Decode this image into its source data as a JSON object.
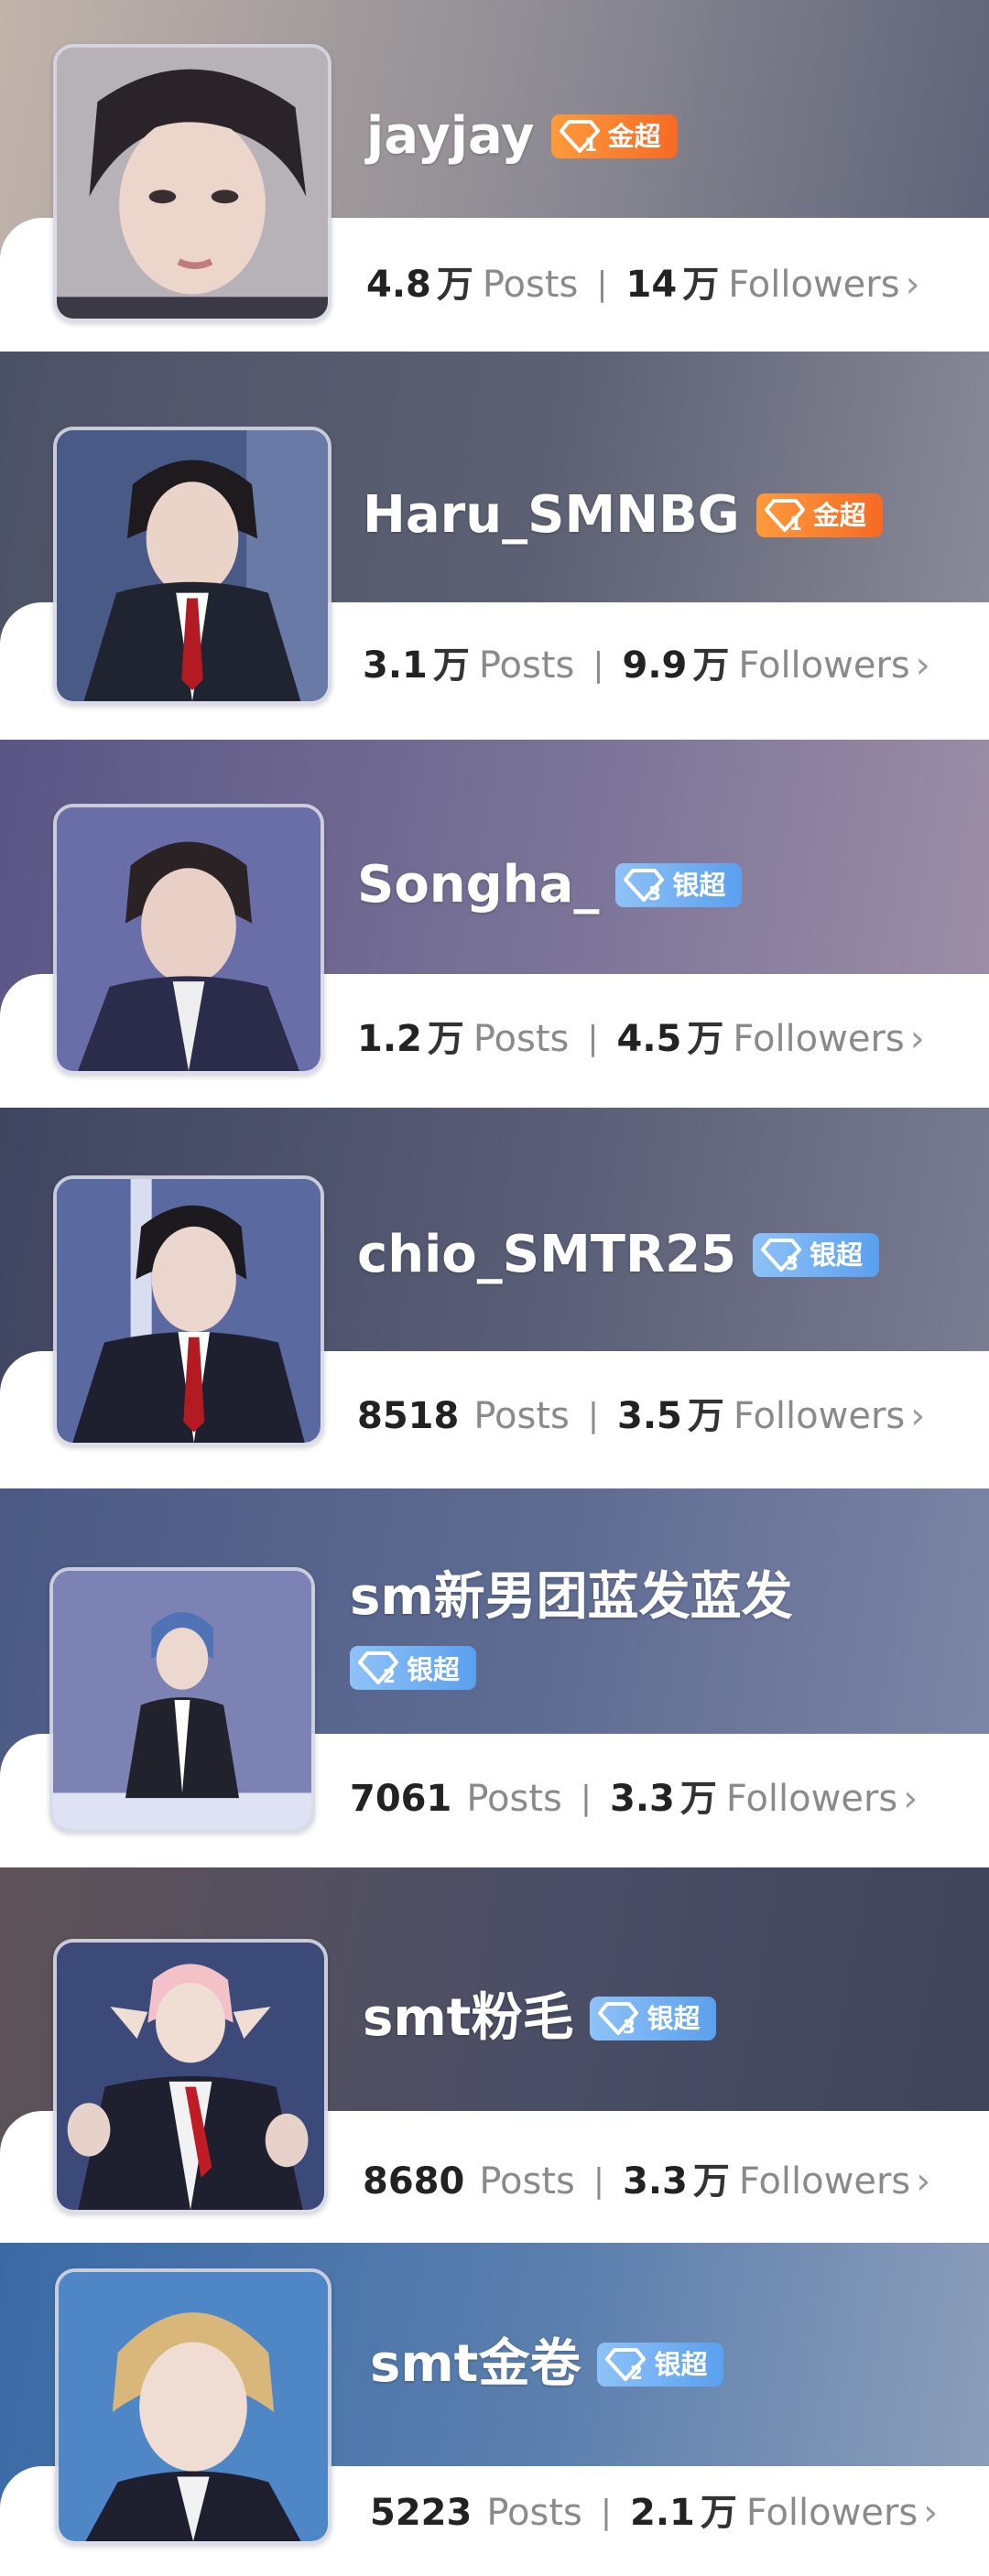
{
  "accounts": [
    {
      "name": "jayjay",
      "badge": {
        "tier": "gold",
        "level": "1",
        "label": "金超"
      },
      "posts": {
        "num": "4.8",
        "unit": "万",
        "label": "Posts"
      },
      "followers": {
        "num": "14",
        "unit": "万",
        "label": "Followers"
      },
      "banner_colors": [
        "#c2b4ab",
        "#8c8a93",
        "#5c6276"
      ]
    },
    {
      "name": "Haru_SMNBG",
      "badge": {
        "tier": "gold",
        "level": "1",
        "label": "金超"
      },
      "posts": {
        "num": "3.1",
        "unit": "万",
        "label": "Posts"
      },
      "followers": {
        "num": "9.9",
        "unit": "万",
        "label": "Followers"
      },
      "banner_colors": [
        "#4c5266",
        "#5d6173",
        "#8b8c9a"
      ]
    },
    {
      "name": "Songha_",
      "badge": {
        "tier": "silver",
        "level": "3",
        "label": "银超"
      },
      "posts": {
        "num": "1.2",
        "unit": "万",
        "label": "Posts"
      },
      "followers": {
        "num": "4.5",
        "unit": "万",
        "label": "Followers"
      },
      "banner_colors": [
        "#5a5585",
        "#7a7398",
        "#9d8fa6"
      ]
    },
    {
      "name": "chio_SMTR25",
      "badge": {
        "tier": "silver",
        "level": "3",
        "label": "银超"
      },
      "posts": {
        "num": "8518",
        "unit": "",
        "label": "Posts"
      },
      "followers": {
        "num": "3.5",
        "unit": "万",
        "label": "Followers"
      },
      "banner_colors": [
        "#3f4560",
        "#5a5e76",
        "#7c7e92"
      ]
    },
    {
      "name": "sm新男团蓝发蓝发",
      "badge": {
        "tier": "silver",
        "level": "2",
        "label": "银超"
      },
      "posts": {
        "num": "7061",
        "unit": "",
        "label": "Posts"
      },
      "followers": {
        "num": "3.3",
        "unit": "万",
        "label": "Followers"
      },
      "banner_colors": [
        "#4b5a84",
        "#5f6c92",
        "#7d86a6"
      ]
    },
    {
      "name": "smt粉毛",
      "badge": {
        "tier": "silver",
        "level": "3",
        "label": "银超"
      },
      "posts": {
        "num": "8680",
        "unit": "",
        "label": "Posts"
      },
      "followers": {
        "num": "3.3",
        "unit": "万",
        "label": "Followers"
      },
      "banner_colors": [
        "#5e5258",
        "#4a4e66",
        "#3e4358"
      ]
    },
    {
      "name": "smt金卷",
      "badge": {
        "tier": "silver",
        "level": "2",
        "label": "银超"
      },
      "posts": {
        "num": "5223",
        "unit": "",
        "label": "Posts"
      },
      "followers": {
        "num": "2.1",
        "unit": "万",
        "label": "Followers"
      },
      "banner_colors": [
        "#3a6aa6",
        "#5b7fae",
        "#8e9fba"
      ]
    }
  ],
  "colors": {
    "gold_badge": "#f56a24",
    "silver_badge": "#5aa0ee",
    "stat_label": "#8a8a8a"
  }
}
